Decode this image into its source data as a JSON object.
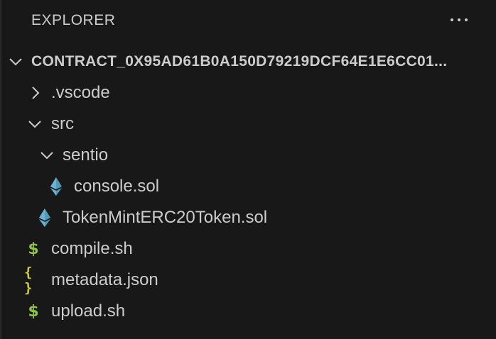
{
  "explorer": {
    "title": "EXPLORER",
    "more_actions_icon": "ellipsis-icon"
  },
  "tree": {
    "root": {
      "label": "CONTRACT_0X95AD61B0A150D79219DCF64E1E6CC01...",
      "expanded": true
    },
    "items": [
      {
        "label": ".vscode",
        "type": "folder",
        "expanded": false
      },
      {
        "label": "src",
        "type": "folder",
        "expanded": true
      },
      {
        "label": "sentio",
        "type": "folder",
        "expanded": true
      },
      {
        "label": "console.sol",
        "type": "file",
        "icon": "ethereum-icon"
      },
      {
        "label": "TokenMintERC20Token.sol",
        "type": "file",
        "icon": "ethereum-icon"
      },
      {
        "label": "compile.sh",
        "type": "file",
        "icon": "shell-dollar-icon"
      },
      {
        "label": "metadata.json",
        "type": "file",
        "icon": "json-braces-icon"
      },
      {
        "label": "upload.sh",
        "type": "file",
        "icon": "shell-dollar-icon"
      }
    ]
  },
  "icons": {
    "dollar_glyph": "$",
    "braces_glyph": "{ }"
  },
  "colors": {
    "background": "#181818",
    "text": "#cccccc",
    "ethereum": "#519aba",
    "shell": "#8dc149",
    "json": "#cbcb41"
  }
}
